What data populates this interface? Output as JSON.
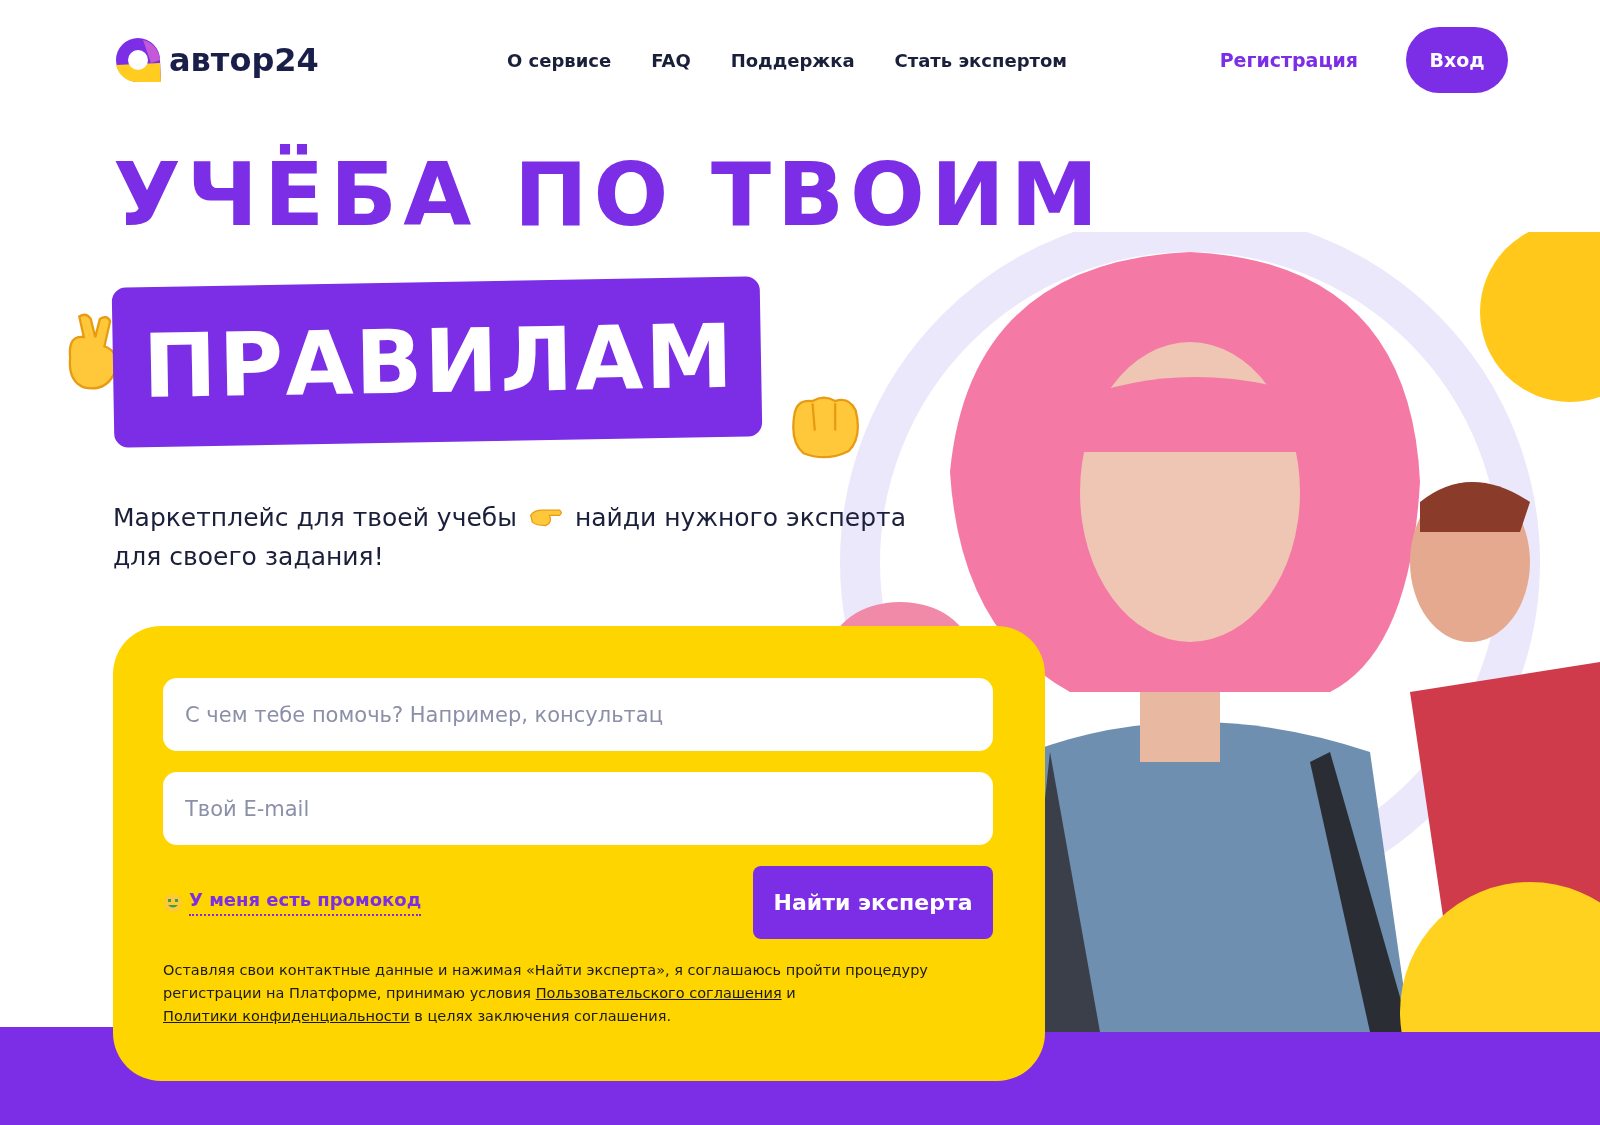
{
  "header": {
    "logo": "автор24",
    "nav": [
      "О сервисе",
      "FAQ",
      "Поддержка",
      "Стать экспертом"
    ],
    "register": "Регистрация",
    "login": "Вход"
  },
  "hero": {
    "title_line_1": "УЧЁБА ПО ТВОИМ",
    "title_line_2": "ПРАВИЛАМ",
    "subtitle_before": "Маркетплейс для твоей учебы",
    "subtitle_after": "найди нужного эксперта",
    "subtitle_line_2": "для своего задания!"
  },
  "form": {
    "task_placeholder": "С чем тебе помочь? Например, консультац",
    "email_placeholder": "Твой E-mail",
    "promo": "У меня есть промокод",
    "submit": "Найти эксперта",
    "legal": [
      {
        "kind": "text",
        "text": "Оставляя свои контактные данные и нажимая «Найти эксперта», я соглашаюсь пройти процедуру регистрации на Платформе, принимаю условия"
      },
      {
        "kind": "link",
        "text": "Пользовательского соглашения"
      },
      {
        "kind": "text",
        "text": "и"
      },
      {
        "kind": "link",
        "text": "Политики конфиденциальности"
      },
      {
        "kind": "text",
        "text": "в целях заключения соглашения."
      }
    ]
  }
}
